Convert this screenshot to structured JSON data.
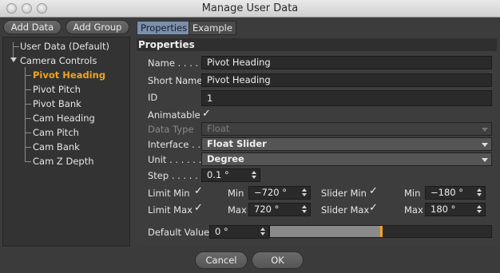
{
  "window": {
    "title": "Manage User Data"
  },
  "toolbar": {
    "add_data": "Add Data",
    "add_group": "Add Group"
  },
  "tabs": [
    "Properties",
    "Example"
  ],
  "tree": {
    "root": "User Data (Default)",
    "group": "Camera Controls",
    "items": [
      "Pivot Heading",
      "Pivot Pitch",
      "Pivot Bank",
      "Cam Heading",
      "Cam Pitch",
      "Cam Bank",
      "Cam Z Depth"
    ],
    "selected": "Pivot Heading"
  },
  "properties": {
    "section": "Properties",
    "name_label": "Name . . . . .",
    "name_value": "Pivot Heading",
    "short_name_label": "Short Name",
    "short_name_value": "Pivot Heading",
    "id_label": "ID",
    "id_value": "1",
    "animatable_label": "Animatable",
    "animatable_check": "✓",
    "data_type_label": "Data Type",
    "data_type_value": "Float",
    "interface_label": "Interface . .",
    "interface_value": "Float Slider",
    "unit_label": "Unit . . . . . .",
    "unit_value": "Degree",
    "step_label": "Step . . . . . .",
    "step_value": "0.1 °",
    "limit_min_label": "Limit Min",
    "limit_min_check": "✓",
    "min_label": "Min",
    "min_value": "−720 °",
    "slider_min_label": "Slider Min",
    "slider_min_check": "✓",
    "slider_min_min_label": "Min",
    "slider_min_value": "−180 °",
    "limit_max_label": "Limit Max",
    "limit_max_check": "✓",
    "max_label": "Max",
    "max_value": "720 °",
    "slider_max_label": "Slider Max",
    "slider_max_check": "✓",
    "slider_max_max_label": "Max",
    "slider_max_value": "180 °",
    "default_value_label": "Default Value",
    "default_value": "0 °",
    "default_slider_fraction": 0.5
  },
  "buttons": {
    "cancel": "Cancel",
    "ok": "OK"
  },
  "colors": {
    "accent": "#f1a31f",
    "tab_active": "#7d8fa6"
  }
}
